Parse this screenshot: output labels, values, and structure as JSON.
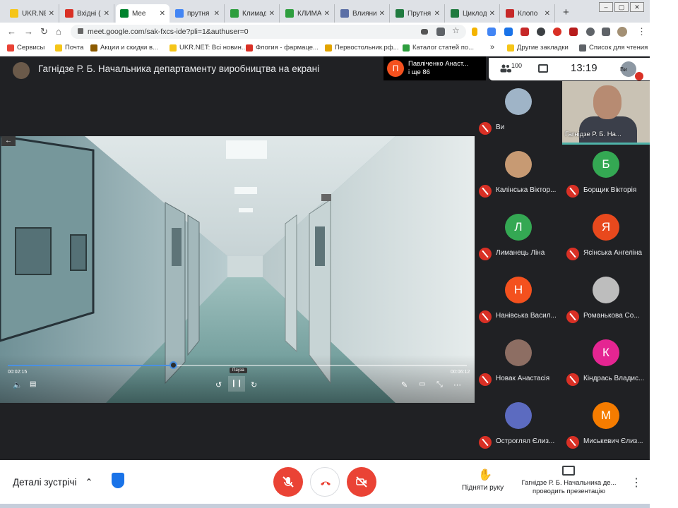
{
  "browser": {
    "tabs": [
      {
        "label": "UKR.NET",
        "favicon_color": "#f5c518"
      },
      {
        "label": "Вхідні (",
        "favicon_color": "#d93025"
      },
      {
        "label": "Mee",
        "favicon_color": "#00832d",
        "active": true
      },
      {
        "label": "прутня",
        "favicon_color": "#4285f4"
      },
      {
        "label": "Климад",
        "favicon_color": "#2e9e3e"
      },
      {
        "label": "КЛИМА",
        "favicon_color": "#2e9e3e"
      },
      {
        "label": "Влияни",
        "favicon_color": "#5b6fa6"
      },
      {
        "label": "Прутня",
        "favicon_color": "#1f7a3f"
      },
      {
        "label": "Циклод",
        "favicon_color": "#1f7a3f"
      },
      {
        "label": "Клопо",
        "favicon_color": "#c62828"
      }
    ],
    "url": "meet.google.com/sak-fxcs-ide?pli=1&authuser=0",
    "bookmarks": [
      {
        "label": "Сервисы",
        "color": "#e94235"
      },
      {
        "label": "Почта",
        "color": "#f5c518"
      },
      {
        "label": "Акции и скидки в...",
        "color": "#8b5a00"
      },
      {
        "label": "UKR.NET: Всі новин...",
        "color": "#f5c518"
      },
      {
        "label": "Флогия - фармаце...",
        "color": "#d93025"
      },
      {
        "label": "Первостольник.рф...",
        "color": "#e2a400"
      },
      {
        "label": "Каталог статей по...",
        "color": "#2e9e3e"
      },
      {
        "label": "Другие закладки",
        "color": "#f5c518"
      },
      {
        "label": "Список для чтения",
        "color": "#5f6368"
      }
    ],
    "bookmarks_more": "»"
  },
  "meet": {
    "presentation_title": "Гагнідзе Р. Б. Начальника департаменту виробництва на екрані",
    "notification": {
      "avatar_letter": "П",
      "line1": "Павліченко Анаст...",
      "line2": "і ще 86"
    },
    "participants_count": "100",
    "clock": "13:19",
    "self_label": "Ви",
    "video": {
      "current_time": "00:02:15",
      "total_time": "00:06:12",
      "progress": 0.36,
      "tooltip": "Пауза"
    },
    "participants": [
      {
        "name": "Ви",
        "letter": "",
        "color": "#9fb4c7"
      },
      {
        "name": "Гагнідзе Р. Б. На...",
        "letter": "",
        "color": "#c9c2b4",
        "speaking": true
      },
      {
        "name": "Калінська Віктор...",
        "letter": "",
        "color": "#c79a73"
      },
      {
        "name": "Борщик Вікторія",
        "letter": "Б",
        "color": "#34a853"
      },
      {
        "name": "Лиманець Ліна",
        "letter": "Л",
        "color": "#34a853"
      },
      {
        "name": "Ясінська Ангеліна",
        "letter": "Я",
        "color": "#e8491d"
      },
      {
        "name": "Нанівська Васил...",
        "letter": "Н",
        "color": "#f4511e"
      },
      {
        "name": "Романькова Со...",
        "letter": "",
        "color": "#bdbdbd"
      },
      {
        "name": "Новак Анастасія",
        "letter": "",
        "color": "#8d6e63"
      },
      {
        "name": "Кіндрась Владис...",
        "letter": "К",
        "color": "#e52592"
      },
      {
        "name": "Остроглял Єлиз...",
        "letter": "",
        "color": "#5c6bc0"
      },
      {
        "name": "Миськевич Єлиз...",
        "letter": "М",
        "color": "#f57c00"
      }
    ],
    "bottom": {
      "details_label": "Деталі зустрічі",
      "raise_hand_label": "Підняти руку",
      "present_line1": "Гагнідзе Р. Б. Начальника де...",
      "present_line2": "проводить презентацію"
    },
    "colors": {
      "accent_red": "#ea4335",
      "mic_red": "#d93025",
      "dark_bg": "#202124",
      "progress_blue": "#4a90e2",
      "speaking_teal": "#4fb3a9"
    }
  }
}
